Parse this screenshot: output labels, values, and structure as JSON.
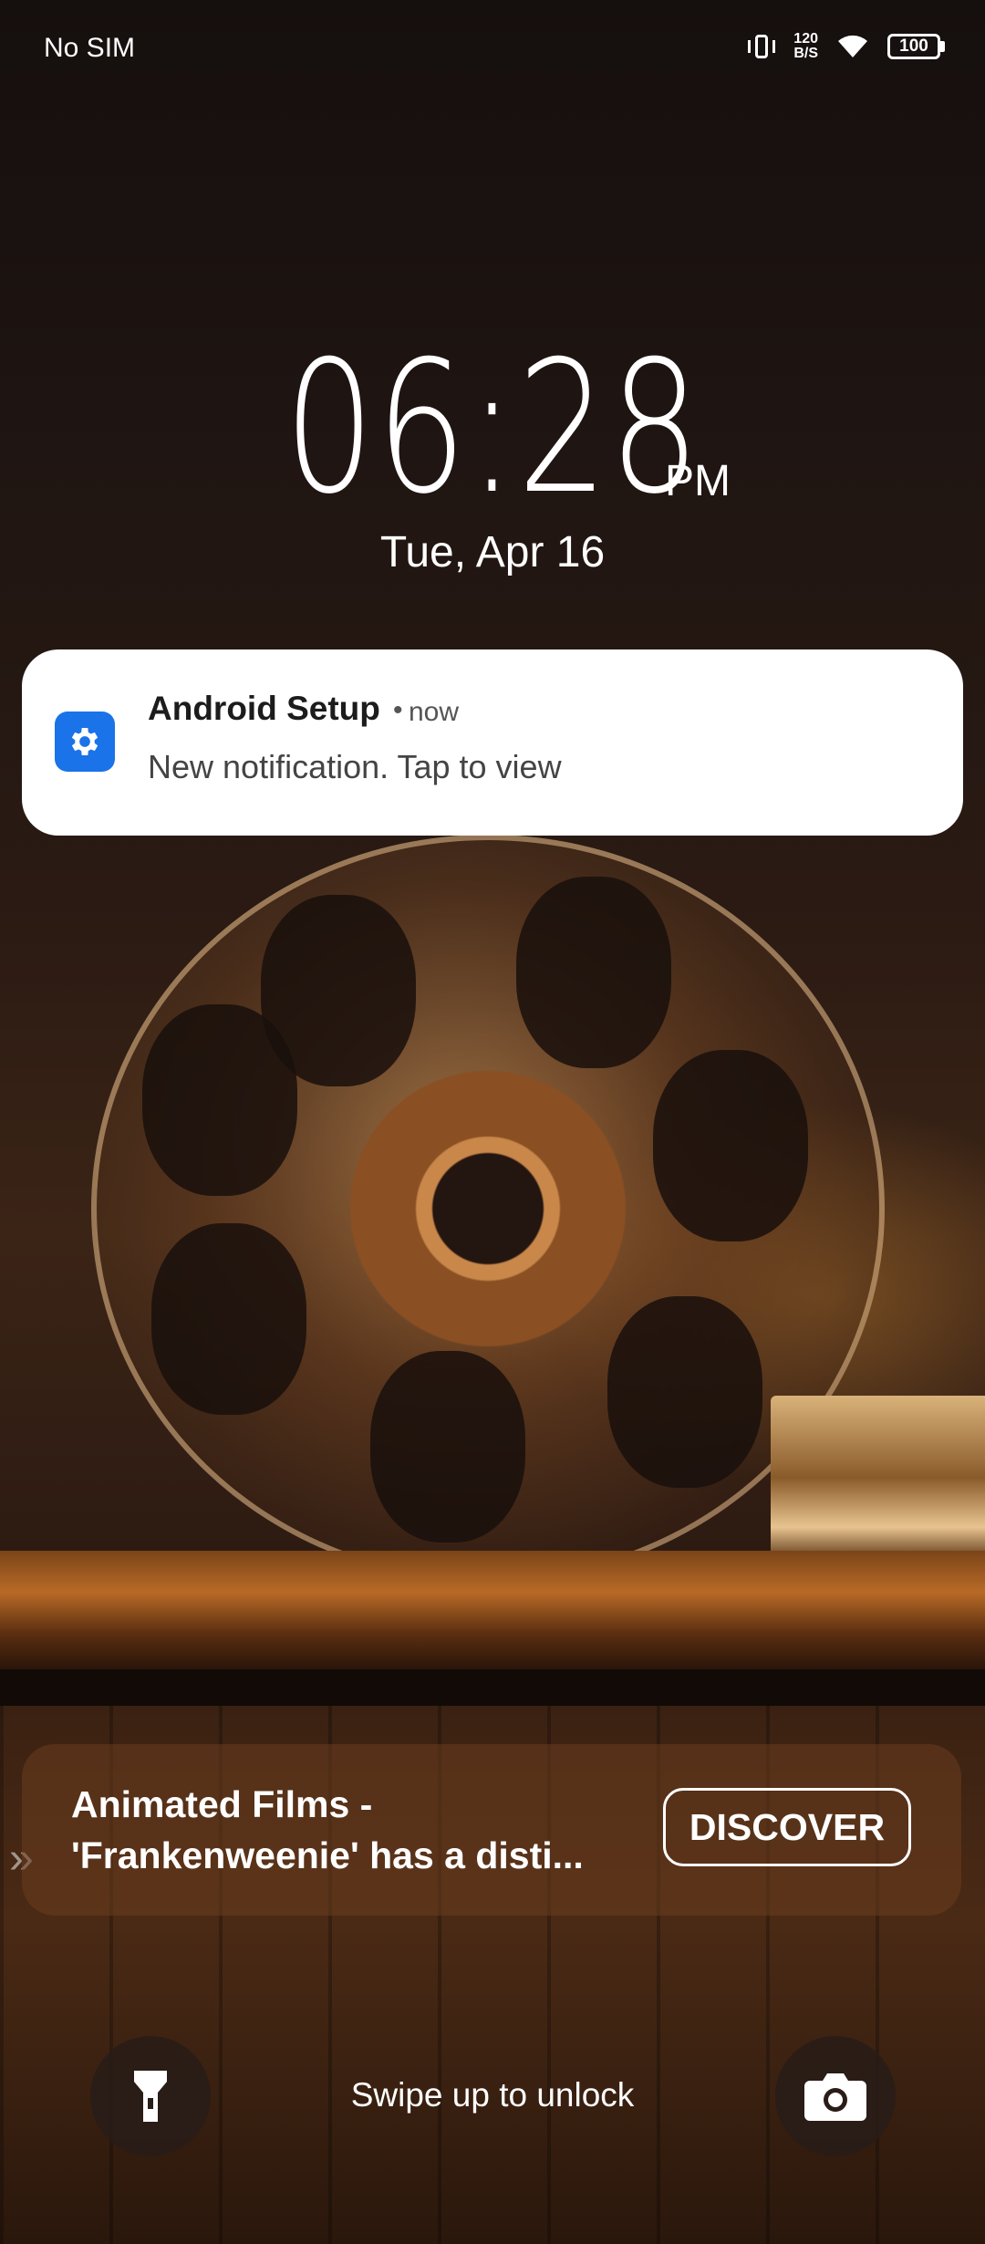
{
  "status_bar": {
    "carrier": "No SIM",
    "net_speed_value": "120",
    "net_speed_unit": "B/S",
    "battery_level": "100",
    "icons": [
      "vibrate-icon",
      "wifi-icon",
      "battery-icon"
    ]
  },
  "clock": {
    "time": "06:28",
    "ampm": "PM",
    "date": "Tue, Apr 16"
  },
  "notification": {
    "app_name": "Android Setup",
    "separator": "•",
    "time": "now",
    "text": "New notification. Tap to view",
    "icon": "settings-gear-icon",
    "accent_color": "#1a73e8"
  },
  "discover": {
    "line1": "Animated Films -",
    "line2": "'Frankenweenie' has a disti...",
    "button_label": "DISCOVER",
    "chevrons": "»"
  },
  "bottom": {
    "swipe_text": "Swipe up to unlock",
    "left_icon": "flashlight-icon",
    "right_icon": "camera-icon"
  }
}
